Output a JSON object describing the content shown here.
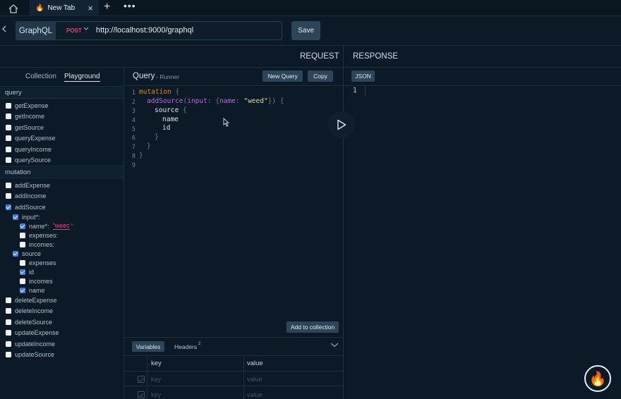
{
  "tabbar": {
    "tab_title": "New Tab",
    "close_glyph": "×",
    "plus_glyph": "+",
    "more_glyph": "•••"
  },
  "request_bar": {
    "protocol": "GraphQL",
    "method": "POST",
    "url": "http://localhost:9000/graphql",
    "save_label": "Save"
  },
  "sections": {
    "request": "REQUEST",
    "response": "RESPONSE"
  },
  "left_panel": {
    "tabs": [
      "Collection",
      "Playground"
    ],
    "query_group": "query",
    "query_items": [
      "getExpense",
      "getIncome",
      "getSource",
      "queryExpense",
      "queryIncome",
      "querySource"
    ],
    "mutation_group": "mutation",
    "mutation_items_top": [
      "addExpense",
      "addIncome",
      "addSource"
    ],
    "input_label": "input*:",
    "name_label": "name*:",
    "name_value": "\"weec",
    "name_quote_end": "\"",
    "expenses_label": "expenses:",
    "incomes_label": "incomes:",
    "source_label": "source",
    "source_fields": [
      "expenses",
      "id",
      "incomes",
      "name"
    ],
    "mutation_items_bottom": [
      "deleteExpense",
      "deleteIncome",
      "deleteSource",
      "updateExpense",
      "updateIncome",
      "updateSource"
    ]
  },
  "editor": {
    "title": "Query",
    "subtitle": "- Runner",
    "new_query_label": "New Query",
    "copy_label": "Copy",
    "line_numbers": [
      "1",
      "2",
      "3",
      "4",
      "5",
      "6",
      "7",
      "8",
      "9"
    ],
    "code": {
      "l1_kw": "mutation",
      "l1_brace": " {",
      "l2_fn": "addSource",
      "l2_open": "(",
      "l2_arg": "input",
      "l2_colon": ": {",
      "l2_arg2": "name",
      "l2_colon2": ": ",
      "l2_str": "\"weed\"",
      "l2_close": "}) {",
      "l3_field": "source",
      "l3_brace": " {",
      "l4_field": "name",
      "l5_field": "id",
      "l6": "}",
      "l7": "}",
      "l8": "}"
    },
    "add_to_collection_label": "Add to collection"
  },
  "bottom_panel": {
    "variables_label": "Variables",
    "headers_label": "Headers",
    "headers_count": "2",
    "col_key": "key",
    "col_value": "value",
    "row_key_placeholder": "key",
    "row_value_placeholder": "value"
  },
  "response": {
    "format_label": "JSON",
    "line_one": "1"
  }
}
